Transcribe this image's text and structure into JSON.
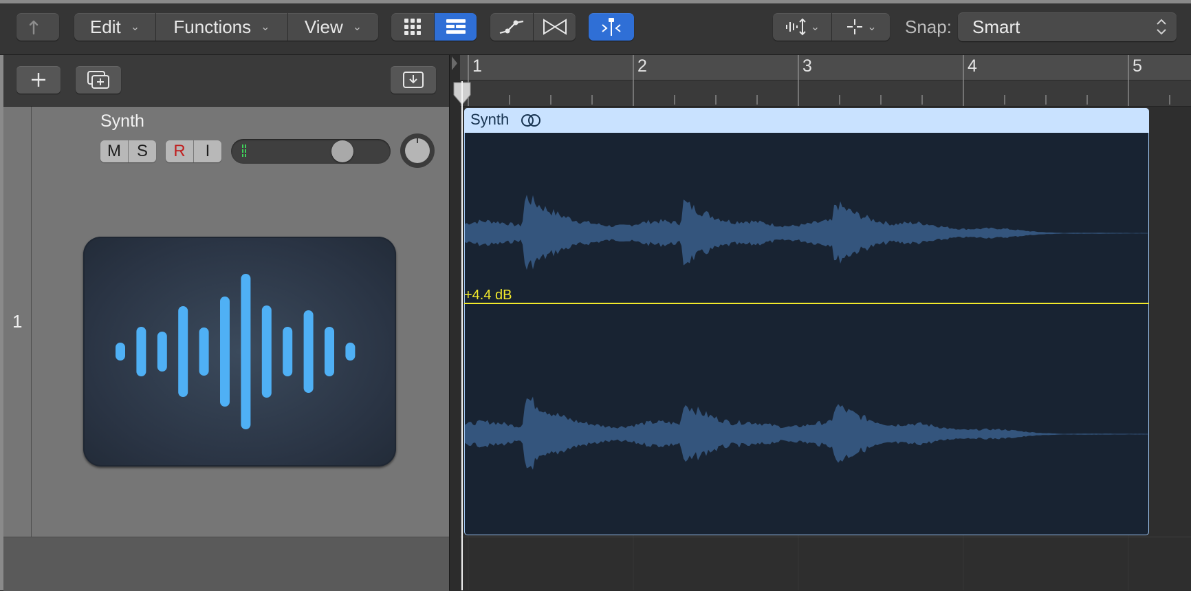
{
  "toolbar": {
    "edit_label": "Edit",
    "functions_label": "Functions",
    "view_label": "View",
    "snap_label": "Snap:",
    "snap_value": "Smart"
  },
  "track": {
    "name": "Synth",
    "number": "1",
    "mute": "M",
    "solo": "S",
    "record": "R",
    "input": "I",
    "record_color": "#c02020"
  },
  "ruler": {
    "bars": [
      "1",
      "2",
      "3",
      "4",
      "5"
    ]
  },
  "region": {
    "name": "Synth",
    "gain_label": "+4.4 dB",
    "header_color": "#c9e2ff",
    "body_color": "#182332",
    "waveform_color": "#34557d",
    "gain_color": "#f3ea2b"
  },
  "colors": {
    "accent": "#2f6fd6",
    "icon_bars": "#4fb0f5"
  }
}
